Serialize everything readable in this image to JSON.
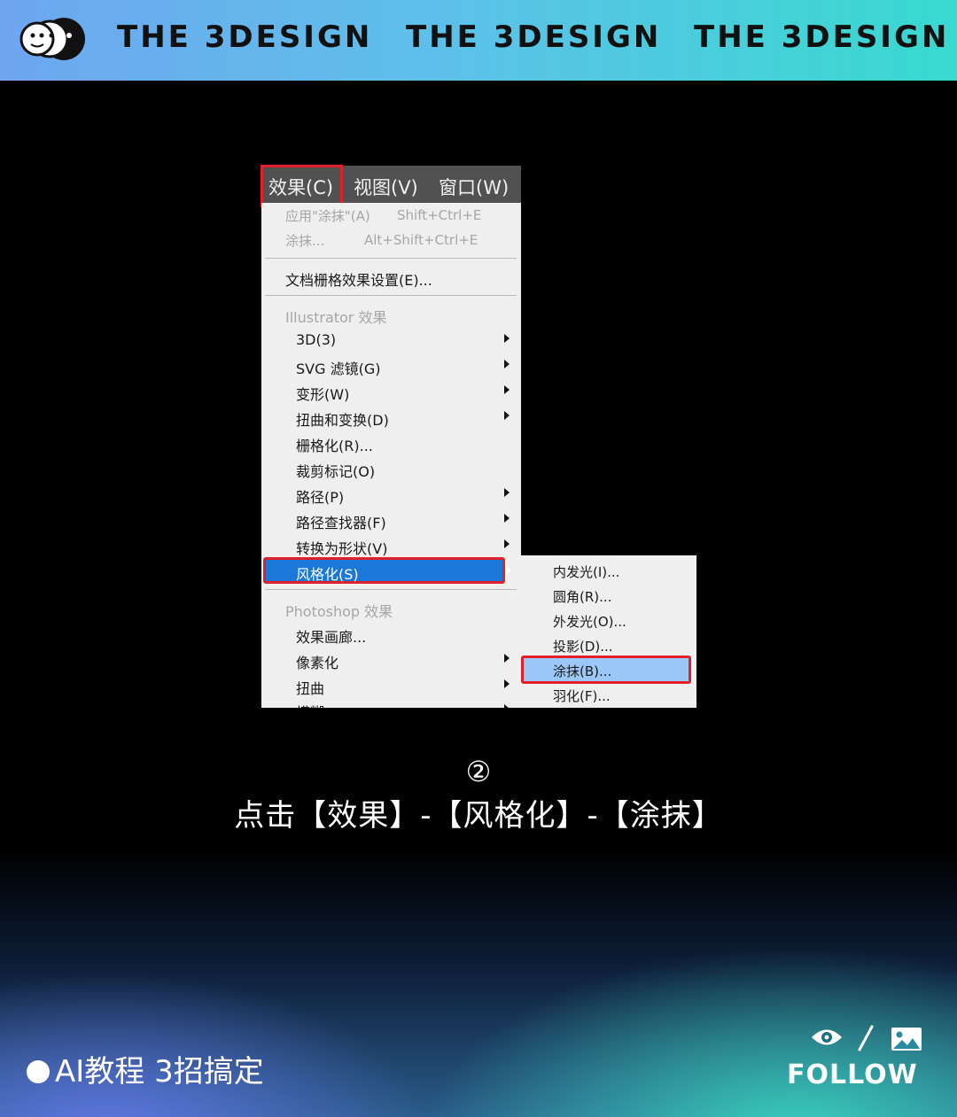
{
  "header": {
    "brand_1": "THE 3DESIGN",
    "brand_2": "THE 3DESIGN",
    "brand_3": "THE 3DESIGN",
    "accent_colors": [
      "#6ea6ef",
      "#38d9cf"
    ]
  },
  "menubar": {
    "effect": "效果(C)",
    "view": "视图(V)",
    "window": "窗口(W)"
  },
  "menu": {
    "apply_last": "应用\"涂抹\"(A)",
    "apply_last_shortcut": "Shift+Ctrl+E",
    "last_effect": "涂抹...",
    "last_effect_shortcut": "Alt+Shift+Ctrl+E",
    "doc_raster": "文档栅格效果设置(E)...",
    "illustrator_header": "Illustrator 效果",
    "illustrator_items": [
      "3D(3)",
      "SVG 滤镜(G)",
      "变形(W)",
      "扭曲和变换(D)",
      "栅格化(R)...",
      "裁剪标记(O)",
      "路径(P)",
      "路径查找器(F)",
      "转换为形状(V)"
    ],
    "stylize": "风格化(S)",
    "photoshop_header": "Photoshop 效果",
    "photoshop_items": [
      "效果画廊...",
      "像素化",
      "扭曲",
      "模糊"
    ],
    "highlight_color": "#1a79d8",
    "annotation_color": "#e2202a"
  },
  "submenu": {
    "items": [
      "内发光(I)...",
      "圆角(R)...",
      "外发光(O)...",
      "投影(D)...",
      "涂抹(B)...",
      "羽化(F)..."
    ]
  },
  "caption": {
    "step": "②",
    "text": "点击【效果】-【风格化】-【涂抹】"
  },
  "footer": {
    "title": "AI教程 3招搞定",
    "follow": "FOLLOW"
  }
}
